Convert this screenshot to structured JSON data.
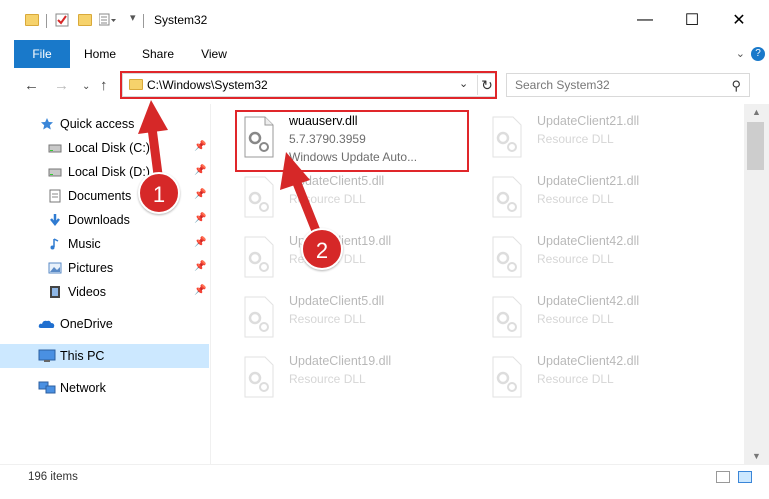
{
  "window": {
    "title": "System32",
    "controls": {
      "minimize": "—",
      "maximize": "☐",
      "close": "✕"
    }
  },
  "ribbon": {
    "tabs": [
      "File",
      "Home",
      "Share",
      "View"
    ]
  },
  "address": {
    "path": "C:\\Windows\\System32"
  },
  "search": {
    "placeholder": "Search System32"
  },
  "sidebar": {
    "items": [
      {
        "label": "Quick access",
        "icon": "star-icon"
      },
      {
        "label": "Local Disk (C:)",
        "icon": "drive-icon",
        "pinned": true
      },
      {
        "label": "Local Disk (D:)",
        "icon": "drive-icon",
        "pinned": true
      },
      {
        "label": "Documents",
        "icon": "documents-icon",
        "pinned": true
      },
      {
        "label": "Downloads",
        "icon": "downloads-icon",
        "pinned": true
      },
      {
        "label": "Music",
        "icon": "music-icon",
        "pinned": true
      },
      {
        "label": "Pictures",
        "icon": "pictures-icon",
        "pinned": true
      },
      {
        "label": "Videos",
        "icon": "videos-icon",
        "pinned": true
      },
      {
        "label": "OneDrive",
        "icon": "onedrive-icon"
      },
      {
        "label": "This PC",
        "icon": "pc-icon",
        "selected": true
      },
      {
        "label": "Network",
        "icon": "network-icon"
      }
    ]
  },
  "files": {
    "highlighted": {
      "name": "wuauserv.dll",
      "version": "5.7.3790.3959",
      "description": "Windows Update Auto..."
    },
    "col1": [
      {
        "name": "UpdateClient5.dll",
        "type": "Resource DLL"
      },
      {
        "name": "UpdateClient19.dll",
        "type": "Resource DLL"
      },
      {
        "name": "UpdateClient5.dll",
        "type": "Resource DLL"
      },
      {
        "name": "UpdateClient19.dll",
        "type": "Resource DLL"
      }
    ],
    "col2": [
      {
        "name": "UpdateClient21.dll",
        "type": "Resource DLL"
      },
      {
        "name": "UpdateClient21.dll",
        "type": "Resource DLL"
      },
      {
        "name": "UpdateClient42.dll",
        "type": "Resource DLL"
      },
      {
        "name": "UpdateClient42.dll",
        "type": "Resource DLL"
      },
      {
        "name": "UpdateClient42.dll",
        "type": "Resource DLL"
      }
    ]
  },
  "status": {
    "item_count": "196 items"
  },
  "annotations": {
    "badge1": "1",
    "badge2": "2",
    "color": "#d62828"
  },
  "colors": {
    "accent": "#1979ca",
    "selection": "#cce8ff",
    "highlight": "#e0262a"
  }
}
